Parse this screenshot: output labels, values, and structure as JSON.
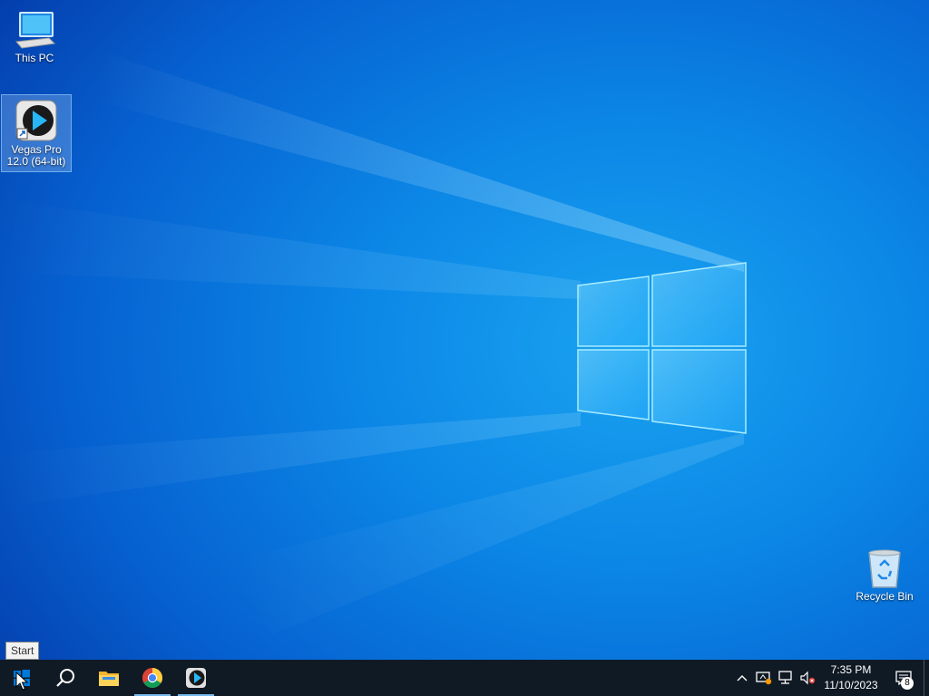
{
  "desktop": {
    "icons": [
      {
        "label": "This PC"
      },
      {
        "label": "Vegas Pro\n12.0 (64-bit)"
      },
      {
        "label": "Recycle Bin"
      }
    ]
  },
  "tooltip": {
    "text": "Start"
  },
  "taskbar": {
    "items": [
      {
        "name": "start-button",
        "icon": "windows-logo-icon"
      },
      {
        "name": "search-button",
        "icon": "search-icon"
      },
      {
        "name": "file-explorer",
        "icon": "folder-icon"
      },
      {
        "name": "google-chrome",
        "icon": "chrome-icon"
      },
      {
        "name": "vegas-pro",
        "icon": "vegas-play-icon"
      }
    ],
    "tray": {
      "clock_time": "7:35 PM",
      "clock_date": "11/10/2023",
      "notification_count": "8"
    }
  },
  "colors": {
    "taskbar_bg": "#101a24",
    "accent": "#76b9ed",
    "desktop_blue": "#0b86e6"
  }
}
